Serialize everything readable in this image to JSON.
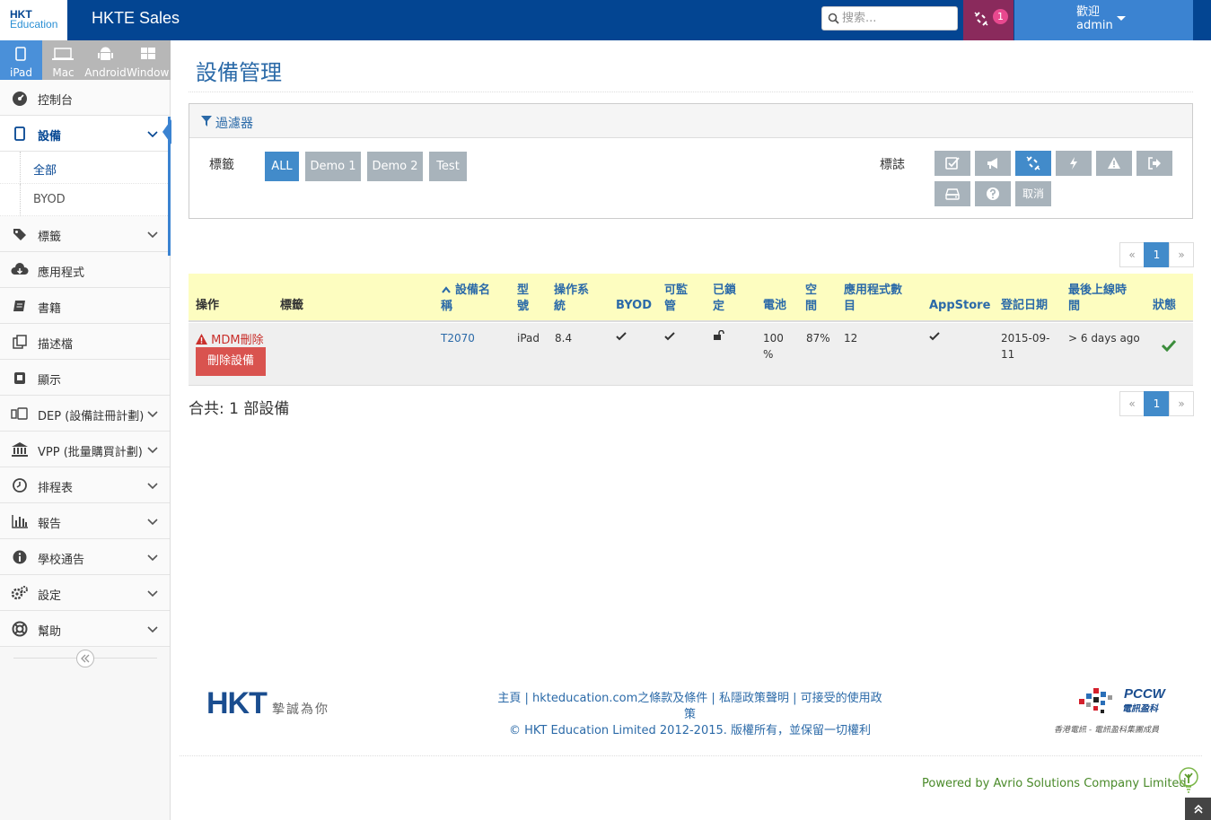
{
  "header": {
    "logo_line1": "HKT",
    "logo_line2": "Education",
    "app_title": "HKTE Sales",
    "search_placeholder": "搜索...",
    "alert_count": "1",
    "welcome": "歡迎",
    "username": "admin"
  },
  "os_tabs": [
    {
      "label": "iPad",
      "icon": "ipad-icon",
      "active": true
    },
    {
      "label": "Mac",
      "icon": "laptop-icon",
      "active": false
    },
    {
      "label": "Android",
      "icon": "android-icon",
      "active": false
    },
    {
      "label": "Windows",
      "icon": "windows-icon",
      "active": false
    }
  ],
  "sidebar": {
    "items": [
      {
        "label": "控制台",
        "icon": "dashboard-icon"
      },
      {
        "label": "設備",
        "icon": "tablet-icon"
      },
      {
        "label": "標籤",
        "icon": "tag-icon"
      },
      {
        "label": "應用程式",
        "icon": "cloud-download-icon"
      },
      {
        "label": "書籍",
        "icon": "book-icon"
      },
      {
        "label": "描述檔",
        "icon": "profile-icon"
      },
      {
        "label": "顯示",
        "icon": "display-icon"
      },
      {
        "label": "DEP (設備註冊計劃)",
        "icon": "devices-icon"
      },
      {
        "label": "VPP (批量購買計劃)",
        "icon": "bank-icon"
      },
      {
        "label": "排程表",
        "icon": "clock-icon"
      },
      {
        "label": "報告",
        "icon": "bar-chart-icon"
      },
      {
        "label": "學校通告",
        "icon": "info-icon"
      },
      {
        "label": "設定",
        "icon": "gears-icon"
      },
      {
        "label": "幫助",
        "icon": "lifebuoy-icon"
      }
    ],
    "sub_items": [
      {
        "label": "全部"
      },
      {
        "label": "BYOD"
      }
    ]
  },
  "main": {
    "title": "設備管理",
    "filter_title": "過濾器",
    "tags_label": "標籤",
    "tags": [
      "ALL",
      "Demo 1",
      "Demo 2",
      "Test"
    ],
    "flags_label": "標誌",
    "flag_cancel": "取消",
    "pager": {
      "prev": "«",
      "page": "1",
      "next": "»"
    },
    "columns": [
      "操作",
      "標籤",
      "設備名稱",
      "型號",
      "操作系統",
      "BYOD",
      "可監管",
      "已鎖定",
      "電池",
      "空間",
      "應用程式數目",
      "AppStore",
      "登記日期",
      "最後上線時間",
      "狀態"
    ],
    "rows": [
      {
        "mdm_delete": "MDM刪除",
        "delete_device": "刪除設備",
        "tags": "",
        "device_name": "T2070",
        "model": "iPad",
        "os": "8.4",
        "battery": "100 %",
        "space": "87%",
        "app_count": "12",
        "enroll_date": "2015-09-11",
        "last_seen": "> 6 days ago"
      }
    ],
    "total": "合共: 1 部設備"
  },
  "footer": {
    "links": "主頁 | hkteducation.com之條款及條件 | 私隱政策聲明 | 可接受的使用政策",
    "copyright": "© HKT Education Limited 2012-2015. 版權所有，並保留一切權利",
    "hkt_logo": "HKT",
    "hkt_slogan": "摯誠為你",
    "pccw_logo": "PCCW",
    "pccw_cn": "電訊盈科",
    "pccw_tagline": "香港電訊 - 電訊盈科集團成員",
    "powered_by": "Powered by Avrio Solutions Company Limited."
  },
  "colors": {
    "brand_navy": "#034592",
    "accent_blue": "#428bca",
    "alert_purple": "#8a2a5c",
    "danger_red": "#d9534f",
    "table_header_yellow": "#fdfdc0"
  }
}
